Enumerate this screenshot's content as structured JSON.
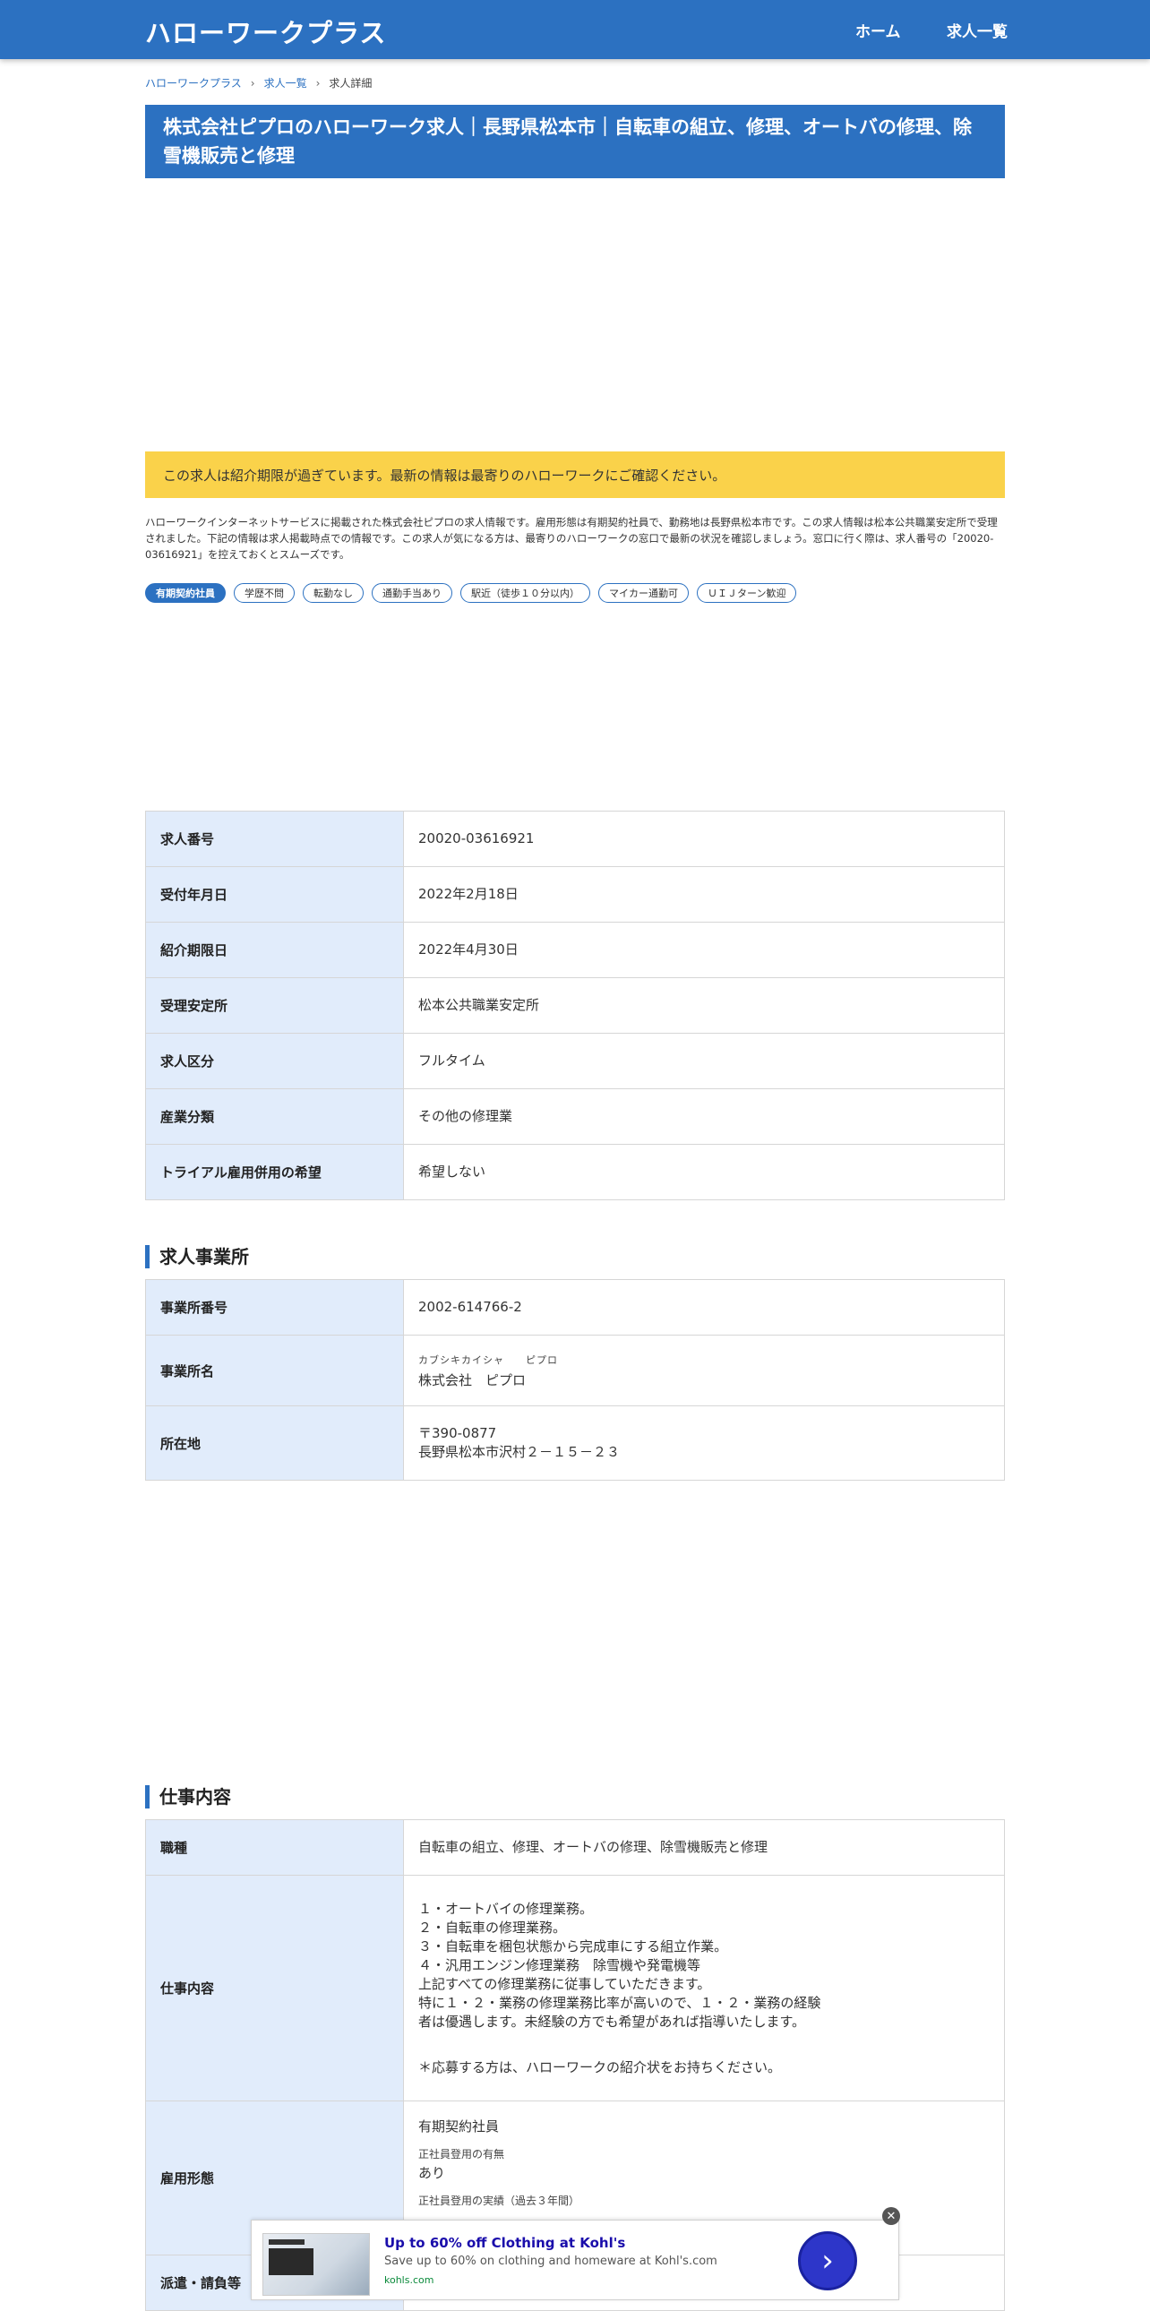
{
  "header": {
    "site_title": "ハローワークプラス",
    "nav": [
      {
        "label": "ホーム"
      },
      {
        "label": "求人一覧"
      }
    ]
  },
  "breadcrumb": [
    {
      "label": "ハローワークプラス"
    },
    {
      "label": "求人一覧"
    },
    {
      "label": "求人詳細"
    }
  ],
  "page_title": "株式会社ピプロのハローワーク求人｜長野県松本市｜自転車の組立、修理、オートバの修理、除雪機販売と修理",
  "notice": "この求人は紹介期限が過ぎています。最新の情報は最寄りのハローワークにご確認ください。",
  "description": "ハローワークインターネットサービスに掲載された株式会社ピプロの求人情報です。雇用形態は有期契約社員で、勤務地は長野県松本市です。この求人情報は松本公共職業安定所で受理されました。下記の情報は求人掲載時点での情報です。この求人が気になる方は、最寄りのハローワークの窓口で最新の状況を確認しましょう。窓口に行く際は、求人番号の「20020-03616921」を控えておくとスムーズです。",
  "tags": [
    {
      "label": "有期契約社員"
    },
    {
      "label": "学歴不問"
    },
    {
      "label": "転勤なし"
    },
    {
      "label": "通勤手当あり"
    },
    {
      "label": "駅近（徒歩１０分以内）"
    },
    {
      "label": "マイカー通勤可"
    },
    {
      "label": "ＵＩＪターン歓迎"
    }
  ],
  "basic_info": [
    {
      "label": "求人番号",
      "value": "20020-03616921"
    },
    {
      "label": "受付年月日",
      "value": "2022年2月18日"
    },
    {
      "label": "紹介期限日",
      "value": "2022年4月30日"
    },
    {
      "label": "受理安定所",
      "value": "松本公共職業安定所"
    },
    {
      "label": "求人区分",
      "value": "フルタイム"
    },
    {
      "label": "産業分類",
      "value": "その他の修理業"
    },
    {
      "label": "トライアル雇用併用の希望",
      "value": "希望しない"
    }
  ],
  "office": {
    "title": "求人事業所",
    "number_label": "事業所番号",
    "number": "2002-614766-2",
    "name_label": "事業所名",
    "name_kana": "カブシキカイシャ　　ピプロ",
    "name": "株式会社　ピプロ",
    "address_label": "所在地",
    "postal": "〒390-0877",
    "address": "長野県松本市沢村２－１５－２３"
  },
  "job": {
    "title": "仕事内容",
    "occupation_label": "職種",
    "occupation": "自転車の組立、修理、オートバの修理、除雪機販売と修理",
    "content_label": "仕事内容",
    "content_lines": [
      "１・オートバイの修理業務。",
      "２・自転車の修理業務。",
      "３・自転車を梱包状態から完成車にする組立作業。",
      "４・汎用エンジン修理業務　除雪機や発電機等",
      "上記すべての修理業務に従事していただきます。",
      "特に１・２・業務の修理業務比率が高いので、１・２・業務の経験",
      "者は優遇します。未経験の方でも希望があれば指導いたします。",
      "",
      "＊応募する方は、ハローワークの紹介状をお持ちください。"
    ],
    "employment_label": "雇用形態",
    "employment": "有期契約社員",
    "regular_label": "正社員登用の有無",
    "regular": "あり",
    "regular_record_label": "正社員登用の実績（過去３年間）",
    "dispatch_label": "派遣・請負等"
  },
  "ad": {
    "title": "Up to 60% off Clothing at Kohl's",
    "text": "Save up to 60% on clothing and homeware at Kohl's.com",
    "domain": "kohls.com"
  }
}
